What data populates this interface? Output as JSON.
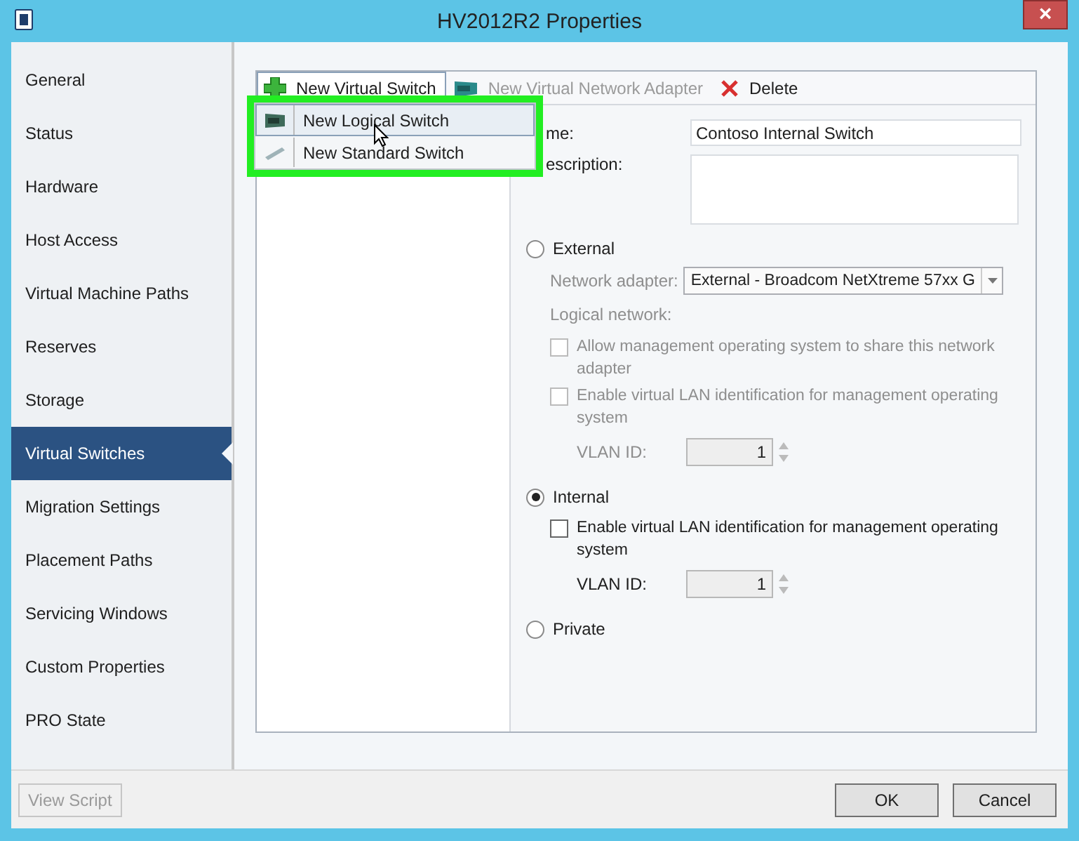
{
  "window": {
    "title": "HV2012R2 Properties",
    "close": "×"
  },
  "sidebar": {
    "items": [
      {
        "label": "General",
        "selected": false
      },
      {
        "label": "Status",
        "selected": false
      },
      {
        "label": "Hardware",
        "selected": false
      },
      {
        "label": "Host Access",
        "selected": false
      },
      {
        "label": "Virtual Machine Paths",
        "selected": false
      },
      {
        "label": "Reserves",
        "selected": false
      },
      {
        "label": "Storage",
        "selected": false
      },
      {
        "label": "Virtual Switches",
        "selected": true
      },
      {
        "label": "Migration Settings",
        "selected": false
      },
      {
        "label": "Placement Paths",
        "selected": false
      },
      {
        "label": "Servicing Windows",
        "selected": false
      },
      {
        "label": "Custom Properties",
        "selected": false
      },
      {
        "label": "PRO State",
        "selected": false
      }
    ]
  },
  "toolbar": {
    "buttons": [
      {
        "kind": "add",
        "label": "New Virtual Switch",
        "disabled": false,
        "pressed": true
      },
      {
        "kind": "adapter",
        "label": "New Virtual Network Adapter",
        "disabled": true,
        "pressed": false
      },
      {
        "kind": "delete",
        "label": "Delete",
        "disabled": false,
        "pressed": false
      }
    ]
  },
  "dropdown_menu": {
    "highlighted": true,
    "items": [
      {
        "kind": "logical",
        "label": "New Logical Switch",
        "selected": true
      },
      {
        "kind": "standard",
        "label": "New Standard Switch",
        "selected": false
      }
    ]
  },
  "form": {
    "name_label": "me:",
    "name_value": "Contoso Internal Switch",
    "description_label": "escription:",
    "switch_types": [
      {
        "label": "External",
        "selected": false,
        "fields": [
          {
            "kind": "select",
            "label": "Network adapter:",
            "value": "External - Broadcom NetXtreme 57xx G",
            "disabled": true
          },
          {
            "kind": "label",
            "label": "Logical network:",
            "disabled": true
          },
          {
            "kind": "checkbox",
            "label": "Allow management operating system to share this network adapter",
            "checked": false,
            "disabled": true
          },
          {
            "kind": "checkbox",
            "label": "Enable virtual LAN identification for management operating system",
            "checked": false,
            "disabled": true
          },
          {
            "kind": "spinner",
            "label": "VLAN ID:",
            "value": "1",
            "disabled": true
          }
        ]
      },
      {
        "label": "Internal",
        "selected": true,
        "fields": [
          {
            "kind": "checkbox",
            "label": "Enable virtual LAN identification for management operating system",
            "checked": false,
            "disabled": false
          },
          {
            "kind": "spinner",
            "label": "VLAN ID:",
            "value": "1",
            "disabled": false
          }
        ]
      },
      {
        "label": "Private",
        "selected": false
      }
    ]
  },
  "footer": {
    "buttons": [
      {
        "label": "View Script",
        "disabled": true
      },
      {
        "label": "OK",
        "disabled": false
      },
      {
        "label": "Cancel",
        "disabled": false
      }
    ]
  }
}
